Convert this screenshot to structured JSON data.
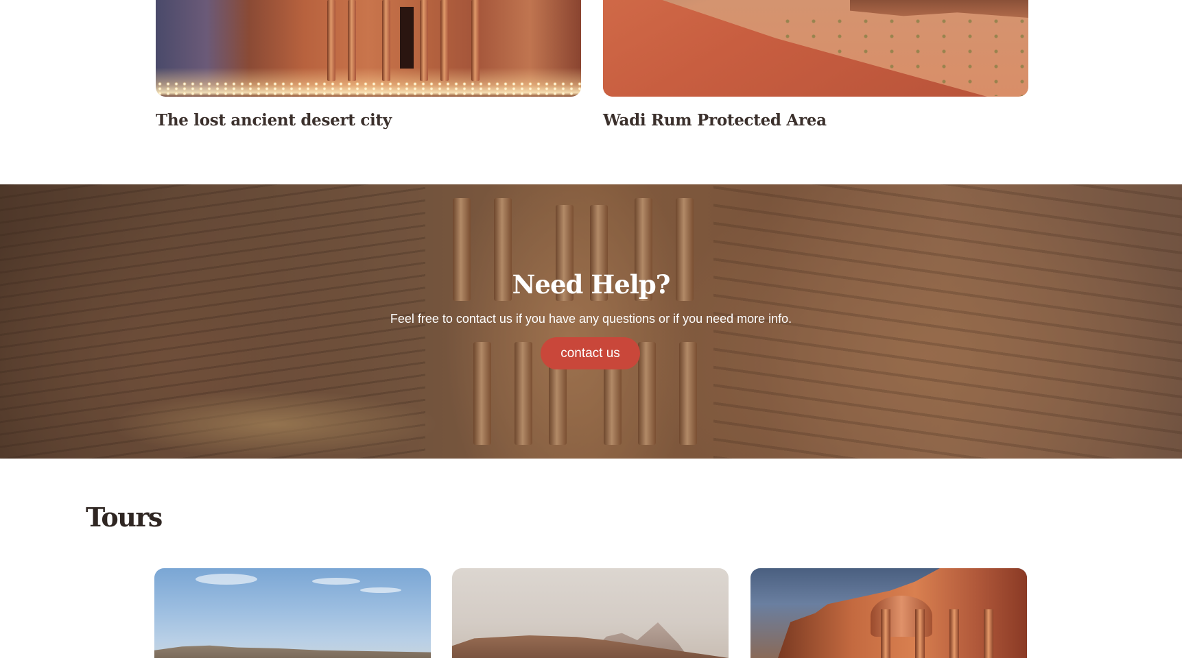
{
  "destinations": [
    {
      "title": "The lost ancient desert city",
      "image": "petra-treasury-by-night"
    },
    {
      "title": "Wadi Rum Protected Area",
      "image": "wadi-rum-desert-dunes"
    }
  ],
  "help_banner": {
    "title": "Need Help?",
    "text": "Feel free to contact us if you have any questions or if you need more info.",
    "button_label": "contact us",
    "button_color": "#c9473a",
    "image": "petra-treasury-aerial"
  },
  "tours": {
    "heading": "Tours",
    "cards": [
      {
        "image": "desert-plateau-blue-sky"
      },
      {
        "image": "wadi-rum-mesa-hazy"
      },
      {
        "image": "petra-monastery"
      }
    ]
  },
  "colors": {
    "text_dark": "#3b302c",
    "accent": "#c9473a",
    "background": "#ffffff"
  }
}
